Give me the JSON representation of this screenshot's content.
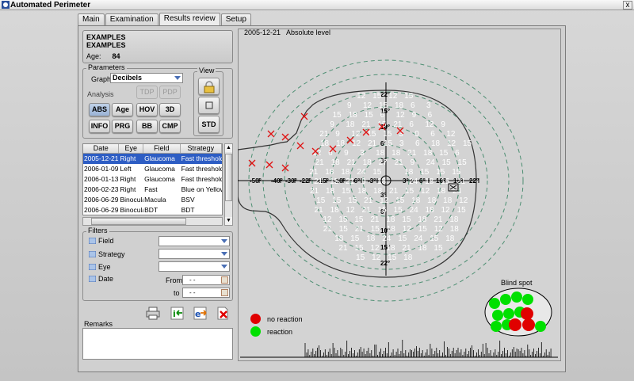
{
  "window": {
    "title": "Automated Perimeter",
    "close_symbol": "x"
  },
  "tabs": [
    {
      "label": "Main"
    },
    {
      "label": "Examination"
    },
    {
      "label": "Results review",
      "active": true
    },
    {
      "label": "Setup"
    }
  ],
  "patient": {
    "line1": "EXAMPLES",
    "line2": "EXAMPLES",
    "age_label": "Age:",
    "age": "84"
  },
  "parameters": {
    "group_label": "Parameters",
    "graph_label": "Graph",
    "graph_value": "Decibels",
    "analysis_label": "Analysis",
    "analysis_buttons": [
      "TDP",
      "PDP",
      "ABS",
      "Age",
      "HOV",
      "3D",
      "INFO",
      "PRG",
      "BB",
      "CMP"
    ],
    "selected": "ABS",
    "view_label": "View",
    "view_std": "STD"
  },
  "exam_table": {
    "columns": [
      "Date",
      "Eye",
      "Field",
      "Strategy"
    ],
    "rows": [
      [
        "2005-12-21",
        "Right",
        "Glaucoma",
        "Fast threshold"
      ],
      [
        "2006-01-09",
        "Left",
        "Glaucoma",
        "Fast threshold"
      ],
      [
        "2006-01-13",
        "Right",
        "Glaucoma",
        "Fast threshold"
      ],
      [
        "2006-02-23",
        "Right",
        "Fast",
        "Blue on Yellow"
      ],
      [
        "2006-06-29",
        "Binocular",
        "Macula",
        "BSV"
      ],
      [
        "2006-06-29",
        "Binocular",
        "BDT",
        "BDT"
      ]
    ],
    "selected_row": 0
  },
  "filters": {
    "group_label": "Filters",
    "field_label": "Field",
    "strategy_label": "Strategy",
    "eye_label": "Eye",
    "date_label": "Date",
    "from_label": "From",
    "to_label": "to",
    "from_value": "-  -",
    "to_value": "-  -"
  },
  "remarks_label": "Remarks",
  "plot": {
    "date": "2005-12-21",
    "level": "Absolute level",
    "h_ticks": [
      "50°",
      "40°",
      "30°",
      "22°",
      "15°",
      "10°",
      "6°",
      "3°",
      "3°",
      "6°",
      "10°",
      "15°",
      "22°"
    ],
    "v_ticks_up": [
      "22°",
      "15°",
      "10°",
      "6°",
      "3°"
    ],
    "v_ticks_down": [
      "3°",
      "6°",
      "10°",
      "15°",
      "22°"
    ],
    "values": [
      "12",
      "15",
      "12",
      "15",
      "9",
      "12",
      "15",
      "18",
      "6",
      "3",
      "15",
      "18",
      "15",
      "6",
      "12",
      "9",
      "6",
      "9",
      "18",
      "21",
      "15",
      "21",
      "6",
      "12",
      "9",
      "21",
      "9",
      "12",
      "15",
      "15",
      "3",
      "0",
      "6",
      "12",
      "18",
      "18",
      "12",
      "21",
      "15",
      "3",
      "6",
      "18",
      "12",
      "15",
      "12",
      "6",
      "9",
      "3",
      "18",
      "18",
      "21",
      "18",
      "15",
      "6",
      "21",
      "18",
      "21",
      "18",
      "27",
      "21",
      "9",
      "24",
      "15",
      "15",
      "21",
      "18",
      "18",
      "24",
      "15",
      "18",
      "15",
      "15",
      "15",
      "21",
      "15",
      "21",
      "9",
      "18",
      "24",
      "18",
      "15",
      "21",
      "21",
      "18",
      "15",
      "18",
      "18",
      "21",
      "15",
      "12",
      "18",
      "24",
      "15",
      "15",
      "15",
      "21",
      "12",
      "15",
      "18",
      "18",
      "18",
      "12",
      "21",
      "18",
      "12",
      "21",
      "15",
      "15",
      "24",
      "18",
      "12",
      "15",
      "12",
      "15",
      "15",
      "21",
      "18",
      "15",
      "18",
      "21",
      "18",
      "21",
      "15",
      "21",
      "15",
      "18",
      "12",
      "15",
      "12",
      "18",
      "18",
      "15",
      "18",
      "24",
      "15",
      "24",
      "15",
      "18",
      "21",
      "15",
      "12",
      "18",
      "21",
      "18",
      "15",
      "15",
      "12",
      "15",
      "18"
    ],
    "legend": {
      "no_reaction": "no reaction",
      "reaction": "reaction"
    },
    "colors": {
      "no_reaction": "#e00000",
      "reaction": "#00e000",
      "marker": "#e01010"
    },
    "blind_spot_label": "Blind spot"
  }
}
